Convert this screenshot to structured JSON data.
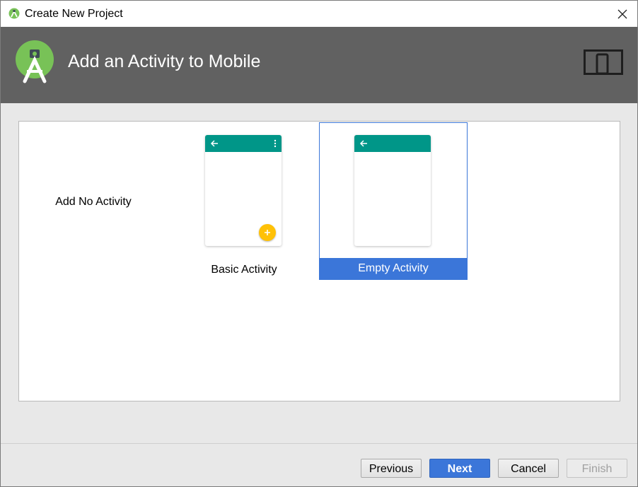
{
  "window": {
    "title": "Create New Project",
    "app_icon": "android-studio-icon",
    "close_icon": "close-icon"
  },
  "header": {
    "heading": "Add an Activity to Mobile",
    "logo": "android-studio-logo",
    "form_factor_icon": "phone-tablet-icon",
    "background_color": "#616161"
  },
  "gallery": {
    "tiles": [
      {
        "label": "Add No Activity",
        "selected": false
      },
      {
        "label": "Basic Activity",
        "selected": false
      },
      {
        "label": "Empty Activity",
        "selected": true
      }
    ],
    "app_bar_color": "#009688",
    "fab_color": "#FFC107",
    "selection_color": "#3B76D9"
  },
  "footer": {
    "previous": "Previous",
    "next": "Next",
    "cancel": "Cancel",
    "finish": "Finish",
    "finish_enabled": false
  }
}
